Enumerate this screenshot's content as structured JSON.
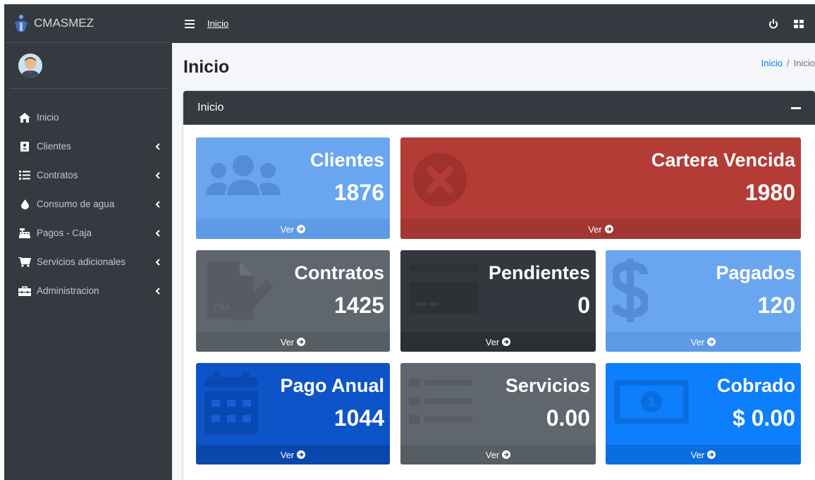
{
  "brand": {
    "name": "CMASMEZ"
  },
  "sidebar": {
    "items": [
      {
        "label": "Inicio",
        "icon": "home-icon",
        "has_submenu": false
      },
      {
        "label": "Clientes",
        "icon": "address-book-icon",
        "has_submenu": true
      },
      {
        "label": "Contratos",
        "icon": "list-icon",
        "has_submenu": true
      },
      {
        "label": "Consumo de agua",
        "icon": "water-drop-icon",
        "has_submenu": true
      },
      {
        "label": "Pagos - Caja",
        "icon": "cash-register-icon",
        "has_submenu": true
      },
      {
        "label": "Servicios adicionales",
        "icon": "cart-icon",
        "has_submenu": true
      },
      {
        "label": "Administracion",
        "icon": "toolbox-icon",
        "has_submenu": true
      }
    ]
  },
  "topbar": {
    "link": "Inicio"
  },
  "page": {
    "title": "Inicio",
    "breadcrumb": {
      "link": "Inicio",
      "sep": "/",
      "current": "Inicio"
    }
  },
  "card": {
    "title": "Inicio"
  },
  "boxes": [
    {
      "title": "Clientes",
      "value": "1876",
      "footer": "Ver",
      "color": "#6aa6f0"
    },
    {
      "title": "Cartera Vencida",
      "value": "1980",
      "footer": "Ver",
      "color": "#b33c37"
    },
    {
      "title": "Contratos",
      "value": "1425",
      "footer": "Ver",
      "color": "#5f666d"
    },
    {
      "title": "Pendientes",
      "value": "0",
      "footer": "Ver",
      "color": "#32383e"
    },
    {
      "title": "Pagados",
      "value": "120",
      "footer": "Ver",
      "color": "#6aa6f0"
    },
    {
      "title": "Pago Anual",
      "value": "1044",
      "footer": "Ver",
      "color": "#0d54c9"
    },
    {
      "title": "Servicios",
      "value": "0.00",
      "footer": "Ver",
      "color": "#5f666d"
    },
    {
      "title": "Cobrado",
      "value": "$ 0.00",
      "footer": "Ver",
      "color": "#0d7efc"
    }
  ],
  "colors": {
    "sidebar_bg": "#343a40",
    "content_bg": "#f4f6f9",
    "link": "#007bff"
  }
}
